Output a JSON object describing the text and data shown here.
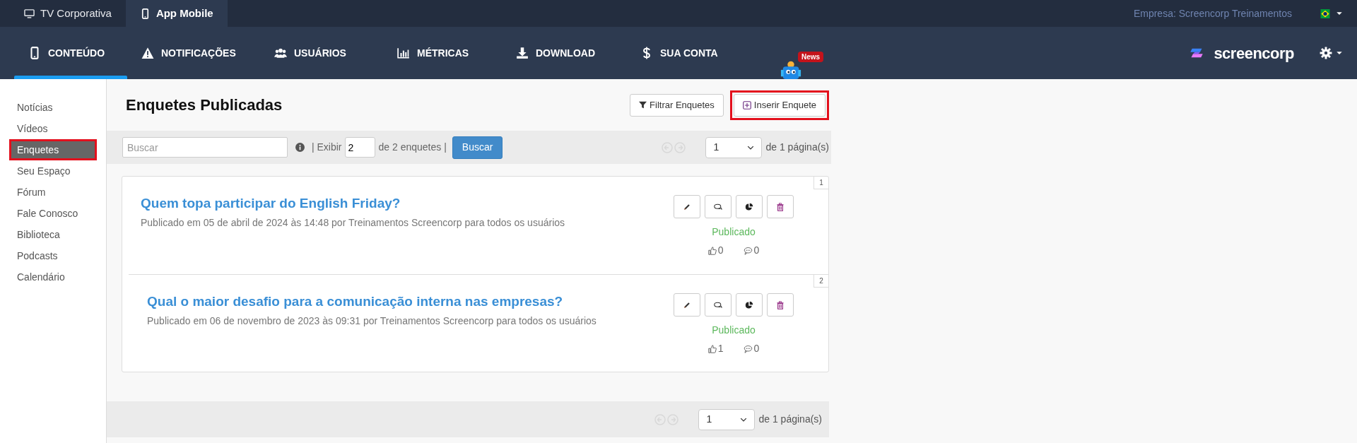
{
  "top_tabs": [
    {
      "label": "TV Corporativa",
      "kind": "monitor",
      "selected": false
    },
    {
      "label": "App Mobile",
      "kind": "phone",
      "selected": true
    }
  ],
  "company": "Empresa: Screencorp Treinamentos",
  "nav": [
    {
      "label": "CONTEÚDO",
      "kind": "phone",
      "selected": true
    },
    {
      "label": "NOTIFICAÇÕES",
      "kind": "warning",
      "selected": false
    },
    {
      "label": "USUÁRIOS",
      "kind": "users",
      "selected": false
    },
    {
      "label": "MÉTRICAS",
      "kind": "chart",
      "selected": false
    },
    {
      "label": "DOWNLOAD",
      "kind": "download",
      "selected": false
    },
    {
      "label": "SUA CONTA",
      "kind": "dollar",
      "selected": false
    }
  ],
  "news_badge": "News",
  "brand": "screencorp",
  "sidebar": [
    {
      "label": "Notícias",
      "selected": false,
      "highlighted": false
    },
    {
      "label": "Vídeos",
      "selected": false,
      "highlighted": false
    },
    {
      "label": "Enquetes",
      "selected": true,
      "highlighted": true
    },
    {
      "label": "Seu Espaço",
      "selected": false,
      "highlighted": false
    },
    {
      "label": "Fórum",
      "selected": false,
      "highlighted": false
    },
    {
      "label": "Fale Conosco",
      "selected": false,
      "highlighted": false
    },
    {
      "label": "Biblioteca",
      "selected": false,
      "highlighted": false
    },
    {
      "label": "Podcasts",
      "selected": false,
      "highlighted": false
    },
    {
      "label": "Calendário",
      "selected": false,
      "highlighted": false
    }
  ],
  "page_title": "Enquetes Publicadas",
  "actions": [
    {
      "label": "Filtrar Enquetes",
      "kind": "filter",
      "highlighted": false
    },
    {
      "label": "Inserir Enquete",
      "kind": "insert",
      "highlighted": true
    }
  ],
  "toolbar": {
    "search_placeholder": "Buscar",
    "show_label": "| Exibir",
    "show_value": "2",
    "count_label": "de 2 enquetes |",
    "search_button": "Buscar",
    "page_value": "1",
    "pages_label": "de 1 página(s)"
  },
  "polls": [
    {
      "number": "1",
      "title": "Quem topa participar do English Friday?",
      "meta": "Publicado em 05 de abril de 2024 às 14:48 por Treinamentos Screencorp para todos os usuários",
      "status": "Publicado",
      "likes": "0",
      "comments": "0"
    },
    {
      "number": "2",
      "title": "Qual o maior desafio para a comunicação interna nas empresas?",
      "meta": "Publicado em 06 de novembro de 2023 às 09:31 por Treinamentos Screencorp para todos os usuários",
      "status": "Publicado",
      "likes": "1",
      "comments": "0"
    }
  ],
  "footer": {
    "page_value": "1",
    "pages_label": "de 1 página(s)"
  }
}
